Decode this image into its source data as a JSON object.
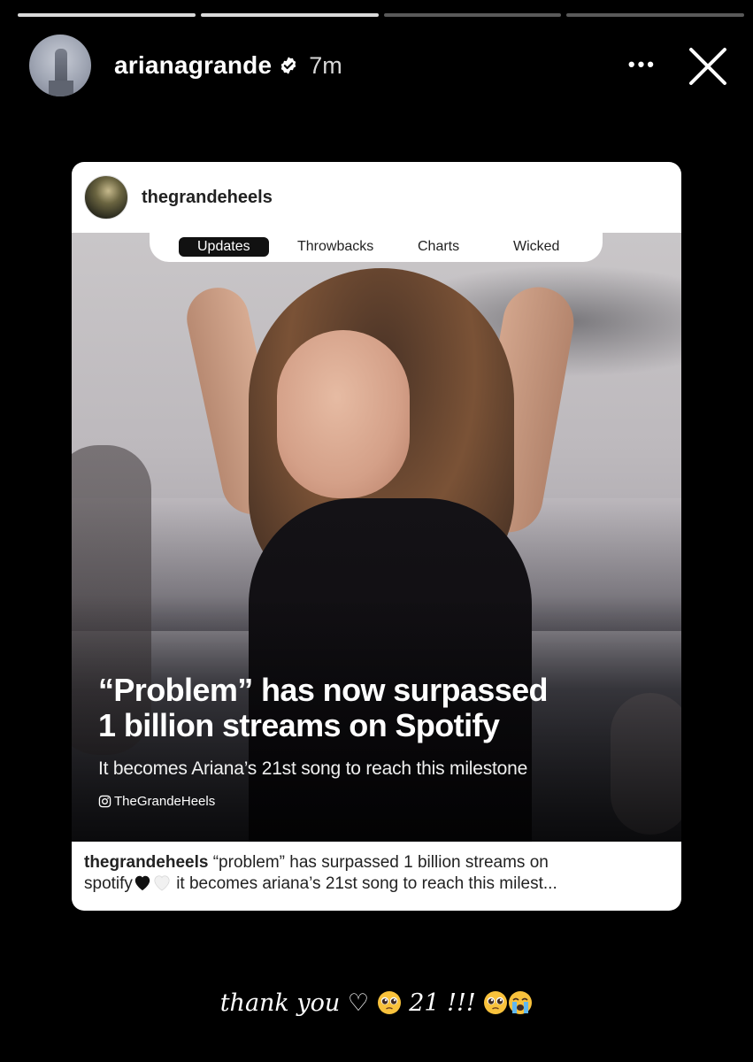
{
  "story": {
    "progress_segments": [
      1.0,
      1.0,
      0.0,
      0.0
    ],
    "header": {
      "username": "arianagrande",
      "time": "7m",
      "more_label": "•••"
    }
  },
  "post": {
    "username": "thegrandeheels",
    "tabs": [
      "Updates",
      "Throwbacks",
      "Charts",
      "Wicked"
    ],
    "active_tab": "Updates",
    "headline": "“Problem” has now surpassed\n1 billion streams on Spotify",
    "subline": "It becomes Ariana’s 21st song to reach this milestone",
    "handle": "TheGrandeHeels",
    "caption_user": "thegrandeheels",
    "caption_text_1": " “problem” has surpassed 1 billion streams on",
    "caption_text_2": "spotify",
    "caption_text_3": " it becomes ariana’s 21st song to reach this milest..."
  },
  "footer": {
    "text_1": "thank you ♡ ",
    "text_2": " 21 !!! ",
    "icons": [
      "pleading-face-emoji",
      "pleading-face-emoji",
      "loudly-crying-face-emoji"
    ]
  },
  "colors": {
    "background": "#000000",
    "card": "#ffffff",
    "tab_active": "#111111"
  }
}
